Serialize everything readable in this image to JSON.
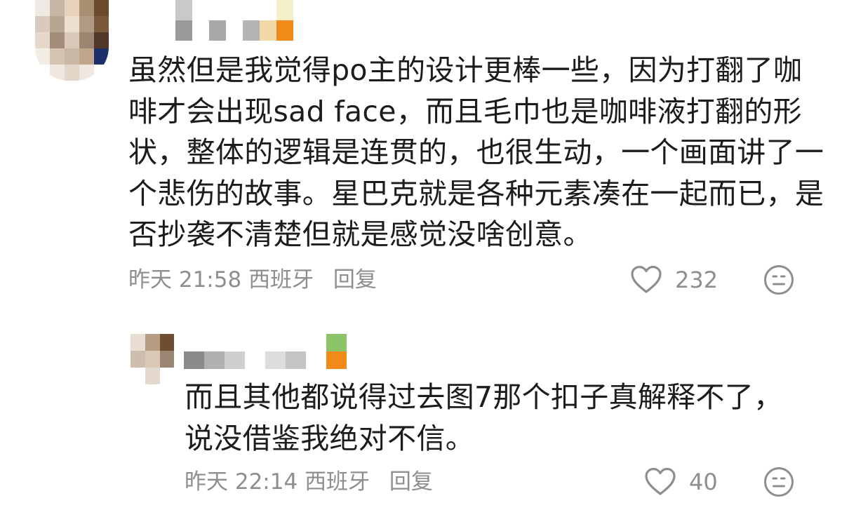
{
  "comments": [
    {
      "text": "虽然但是我觉得po主的设计更棒一些，因为打翻了咖啡才会出现sad face，而且毛巾也是咖啡液打翻的形状，整体的逻辑是连贯的，也很生动，一个画面讲了一个悲伤的故事。星巴克就是各种元素凑在一起而已，是否抄袭不清楚但就是感觉没啥创意。",
      "time": "昨天 21:58",
      "location": "西班牙",
      "reply": "回复",
      "likes": "232",
      "icons": {
        "like": "heart-outline-icon",
        "dislike": "neutral-face-icon"
      }
    },
    {
      "text": "而且其他都说得过去图7那个扣子真解释不了，说没借鉴我绝对不信。",
      "time": "昨天 22:14",
      "location": "西班牙",
      "reply": "回复",
      "likes": "40",
      "icons": {
        "like": "heart-outline-icon",
        "dislike": "neutral-face-icon"
      }
    }
  ],
  "colors": {
    "text": "#1c1c1c",
    "meta": "#8e8e8e",
    "badge": "#f28a1a"
  }
}
